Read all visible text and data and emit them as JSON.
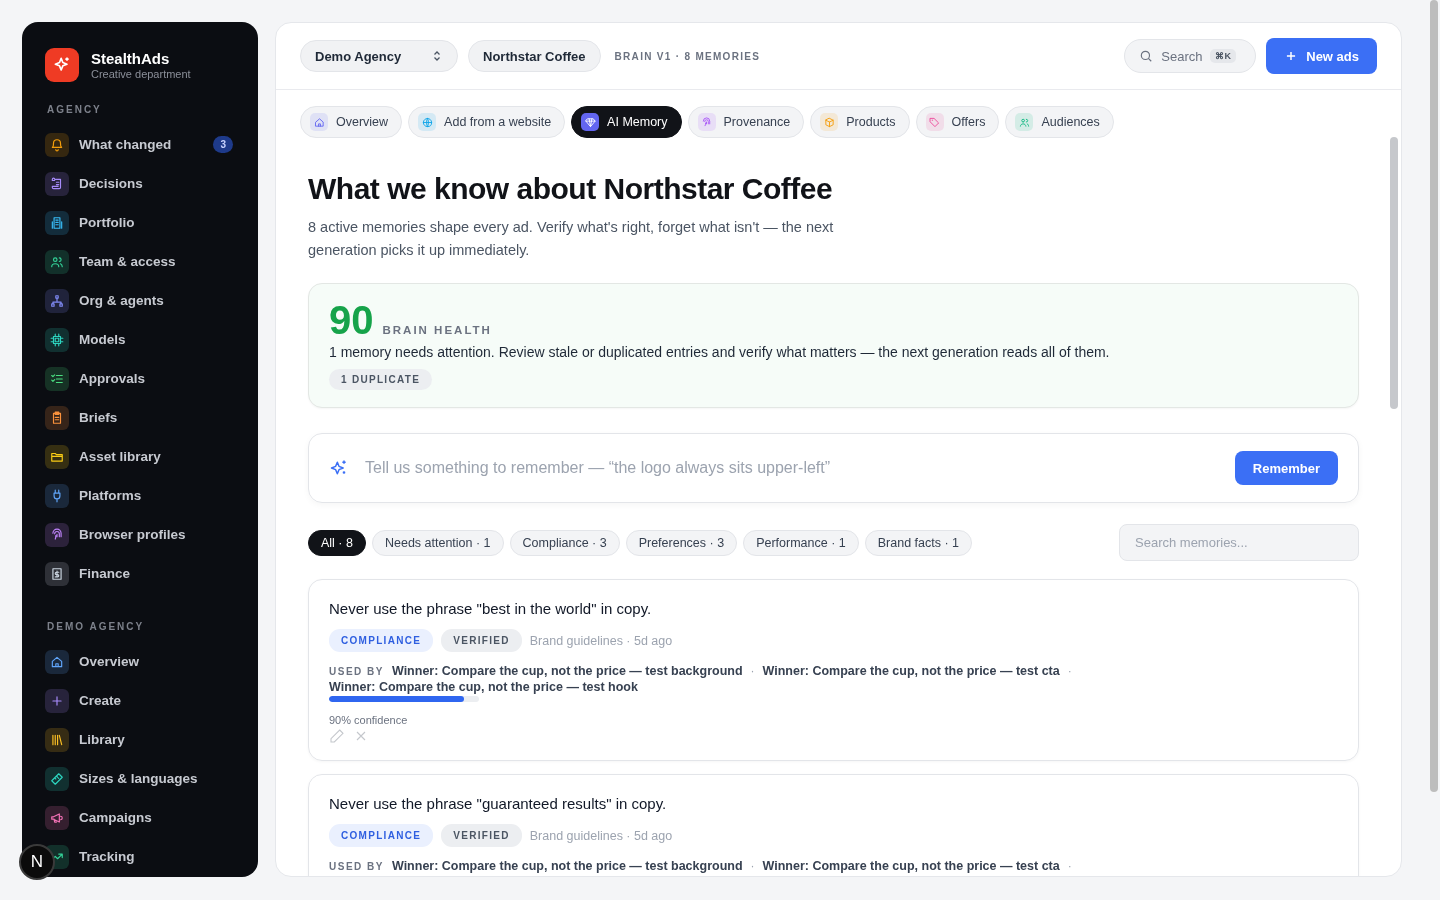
{
  "brand": {
    "name": "StealthAds",
    "subtitle": "Creative department"
  },
  "sidebar": {
    "sections": [
      {
        "label": "AGENCY",
        "items": [
          {
            "label": "What changed",
            "badge": "3",
            "selected": false
          },
          {
            "label": "Decisions",
            "selected": false
          },
          {
            "label": "Portfolio",
            "selected": false
          },
          {
            "label": "Team & access",
            "selected": false
          },
          {
            "label": "Org & agents",
            "selected": false
          },
          {
            "label": "Models",
            "selected": false
          },
          {
            "label": "Approvals",
            "selected": false
          },
          {
            "label": "Briefs",
            "selected": false
          },
          {
            "label": "Asset library",
            "selected": false
          },
          {
            "label": "Platforms",
            "selected": false
          },
          {
            "label": "Browser profiles",
            "selected": false
          },
          {
            "label": "Finance",
            "selected": false
          }
        ]
      },
      {
        "label": "DEMO AGENCY",
        "items": [
          {
            "label": "Overview",
            "selected": false
          },
          {
            "label": "Create",
            "selected": false
          },
          {
            "label": "Library",
            "selected": false
          },
          {
            "label": "Sizes & languages",
            "selected": false
          },
          {
            "label": "Campaigns",
            "selected": false
          },
          {
            "label": "Tracking",
            "selected": false
          }
        ]
      }
    ]
  },
  "dev_badge": "N",
  "header": {
    "workspace": "Demo Agency",
    "client": "Northstar Coffee",
    "meta": "BRAIN V1 · 8 MEMORIES",
    "search": {
      "label": "Search",
      "shortcut": "⌘K"
    },
    "primary_button": "New ads"
  },
  "tabs": [
    {
      "label": "Overview",
      "selected": false
    },
    {
      "label": "Add from a website",
      "selected": false
    },
    {
      "label": "AI Memory",
      "selected": true
    },
    {
      "label": "Provenance",
      "selected": false
    },
    {
      "label": "Products",
      "selected": false
    },
    {
      "label": "Offers",
      "selected": false
    },
    {
      "label": "Audiences",
      "selected": false
    }
  ],
  "page": {
    "title": "What we know about Northstar Coffee",
    "subtitle": "8 active memories shape every ad. Verify what's right, forget what isn't — the next generation picks it up immediately."
  },
  "health": {
    "score": "90",
    "label": "BRAIN HEALTH",
    "message": "1 memory needs attention. Review stale or duplicated entries and verify what matters — the next generation reads all of them.",
    "tags": [
      "1 DUPLICATE"
    ]
  },
  "remember": {
    "placeholder": "Tell us something to remember — “the logo always sits upper-left”",
    "button": "Remember"
  },
  "filters": [
    {
      "label": "All · 8",
      "selected": true
    },
    {
      "label": "Needs attention · 1",
      "selected": false
    },
    {
      "label": "Compliance · 3",
      "selected": false
    },
    {
      "label": "Preferences · 3",
      "selected": false
    },
    {
      "label": "Performance · 1",
      "selected": false
    },
    {
      "label": "Brand facts · 1",
      "selected": false
    }
  ],
  "memory_search": {
    "placeholder": "Search memories..."
  },
  "memories": [
    {
      "text": "Never use the phrase \"best in the world\" in copy.",
      "category": "COMPLIANCE",
      "status": "VERIFIED",
      "source": "Brand guidelines · 5d ago",
      "used_by_label": "USED BY",
      "used_by": [
        "Winner: Compare the cup, not the price — test background",
        "·",
        "Winner: Compare the cup, not the price — test cta",
        "·",
        "Winner: Compare the cup, not the price — test hook"
      ],
      "level": 0.9,
      "confidence": "90% confidence"
    },
    {
      "text": "Never use the phrase \"guaranteed results\" in copy.",
      "category": "COMPLIANCE",
      "status": "VERIFIED",
      "source": "Brand guidelines · 5d ago",
      "used_by_label": "USED BY",
      "used_by": [
        "Winner: Compare the cup, not the price — test background",
        "·",
        "Winner: Compare the cup, not the price — test cta",
        "·"
      ]
    }
  ]
}
